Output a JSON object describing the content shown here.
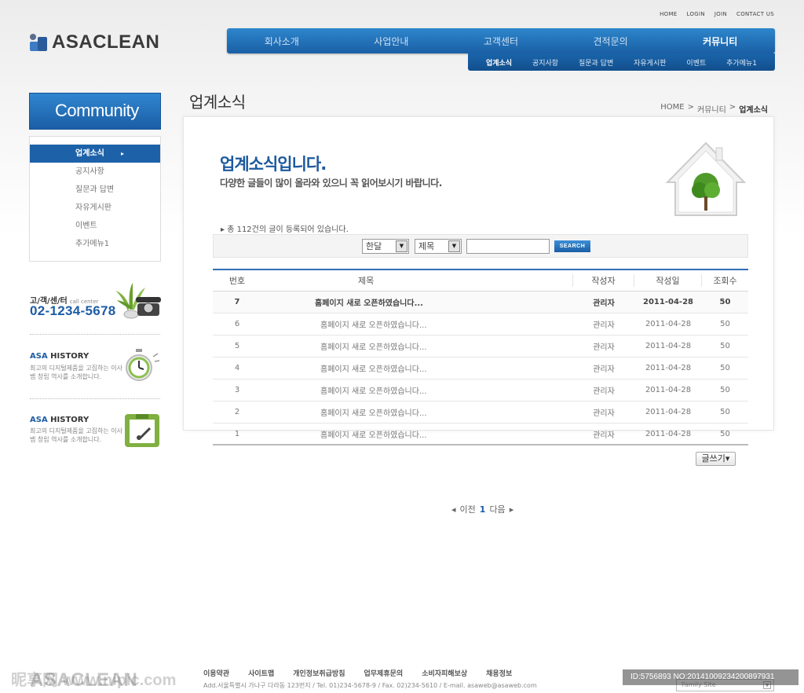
{
  "util_links": [
    "HOME",
    "LOGIN",
    "JOIN",
    "CONTACT US"
  ],
  "logo": {
    "text": "ASACLEAN"
  },
  "gnb": {
    "items": [
      "회사소개",
      "사업안내",
      "고객센터",
      "견적문의",
      "커뮤니티"
    ],
    "active": "커뮤니티"
  },
  "subnav": {
    "items": [
      "업계소식",
      "공지사항",
      "질문과 답변",
      "자유게시판",
      "이벤트",
      "추가메뉴1"
    ],
    "active": "업계소식"
  },
  "sidebar": {
    "title": "Community",
    "items": [
      "업계소식",
      "공지사항",
      "질문과 답변",
      "자유게시판",
      "이벤트",
      "추가메뉴1"
    ],
    "call_center": {
      "label": "고/객/센/터",
      "sub": "call center",
      "phone": "02-1234-5678"
    },
    "history1": {
      "accent": "ASA",
      "title": "HISTORY",
      "desc": "최고의 디지털제품을 고집하는 이사뱁 창립 역사를 소개합니다."
    },
    "history2": {
      "accent": "ASA",
      "title": "HISTORY",
      "desc": "최고의 디지털제품을 고집하는 이사뱁 창립 역사를 소개합니다."
    }
  },
  "main": {
    "page_title": "업계소식",
    "breadcrumb": [
      "HOME",
      "커뮤니티",
      "업계소식"
    ],
    "intro_title": "업계소식입니다.",
    "intro_sub": "다양한 글들이 많이 올라와 있으니 꼭 읽어보시기 바랍니다.",
    "total_text": "총 112건의 글이 등록되어 있습니다.",
    "search": {
      "select1": "한달",
      "select2": "제목",
      "input_value": "",
      "button": "SEARCH"
    },
    "table": {
      "headers": [
        "번호",
        "제목",
        "작성자",
        "작성일",
        "조회수"
      ],
      "rows": [
        {
          "no": "7",
          "title": "홈페이지 새로 오픈하였습니다...",
          "author": "관리자",
          "date": "2011-04-28",
          "views": "50"
        },
        {
          "no": "6",
          "title": "홈페이지 새로 오픈하였습니다...",
          "author": "관리자",
          "date": "2011-04-28",
          "views": "50"
        },
        {
          "no": "5",
          "title": "홈페이지 새로 오픈하였습니다...",
          "author": "관리자",
          "date": "2011-04-28",
          "views": "50"
        },
        {
          "no": "4",
          "title": "홈페이지 새로 오픈하였습니다...",
          "author": "관리자",
          "date": "2011-04-28",
          "views": "50"
        },
        {
          "no": "3",
          "title": "홈페이지 새로 오픈하였습니다...",
          "author": "관리자",
          "date": "2011-04-28",
          "views": "50"
        },
        {
          "no": "2",
          "title": "홈페이지 새로 오픈하였습니다...",
          "author": "관리자",
          "date": "2011-04-28",
          "views": "50"
        },
        {
          "no": "1",
          "title": "홈페이지 새로 오픈하였습니다...",
          "author": "관리자",
          "date": "2011-04-28",
          "views": "50"
        }
      ]
    },
    "write_button": "글쓰기",
    "pager": {
      "prev": "이전",
      "current": "1",
      "next": "다음"
    }
  },
  "footer": {
    "logo": "ASACLEAN",
    "links": [
      "이용약관",
      "사이트맵",
      "개인정보취급방침",
      "업무제휴문의",
      "소비자피해보상",
      "채용정보"
    ],
    "address": "Add.서울특별시 가나구 다라동 123번지 / Tel. 01)234-5678-9 / Fax. 02)234-5610 / E-mail. asaweb@asaweb.com",
    "family_site": "Family Site"
  },
  "overlay": {
    "watermark": "昵享网 www.nipic.com",
    "id_text": "ID:5756893 NO:20141009234200897931"
  },
  "colors": {
    "primary": "#1d5ca6",
    "nav_top": "#2d86cc",
    "nav_bottom": "#1a5fa5"
  }
}
